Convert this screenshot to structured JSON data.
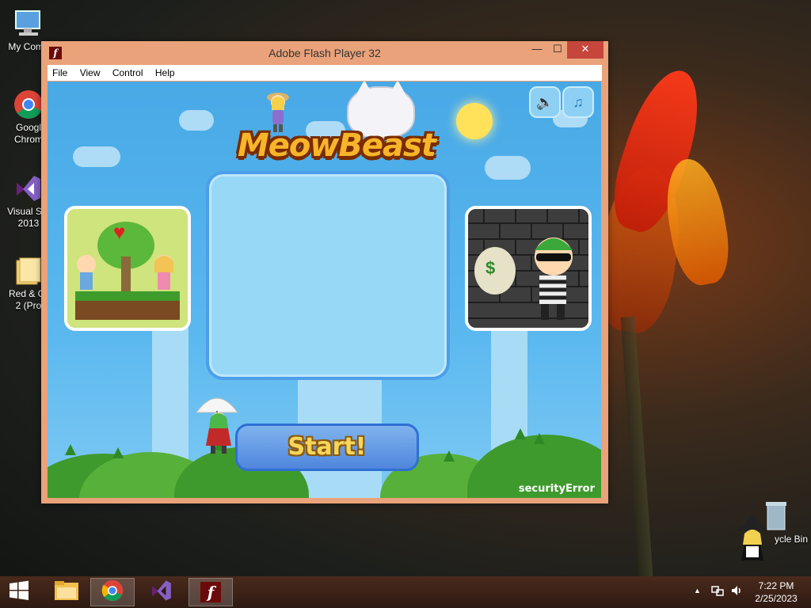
{
  "desktop": {
    "icons": [
      {
        "label": "My Comp",
        "icon": "computer-icon"
      },
      {
        "label": "Googl",
        "label2": "Chrom",
        "icon": "chrome-icon"
      },
      {
        "label": "Visual Stu",
        "label2": "2013",
        "icon": "visual-studio-icon"
      },
      {
        "label": "Red & Gr",
        "label2": "2 (Pro",
        "icon": "folder-icon"
      },
      {
        "label": "ycle Bin",
        "icon": "recycle-bin-icon"
      }
    ]
  },
  "window": {
    "title": "Adobe Flash Player 32",
    "app_icon_glyph": "f",
    "controls": {
      "minimize": "—",
      "maximize": "☐",
      "close": "✕"
    },
    "menu": [
      "File",
      "View",
      "Control",
      "Help"
    ]
  },
  "game": {
    "logo_text": "MeowBeast",
    "sound_icon": "speaker-icon",
    "music_icon": "music-note-icon",
    "start_label": "Start!",
    "error_text": "securityError",
    "thumb_left_icon": "heart-icon",
    "thumb_right_icon": "money-bag-icon",
    "money_symbol": "$"
  },
  "taskbar": {
    "start_icon": "windows-logo-icon",
    "apps": [
      {
        "name": "file-explorer",
        "icon": "folder-icon",
        "active": false
      },
      {
        "name": "chrome",
        "icon": "chrome-icon",
        "active": true
      },
      {
        "name": "visual-studio",
        "icon": "visual-studio-icon",
        "active": false
      },
      {
        "name": "flash-player",
        "icon": "flash-icon",
        "active": true
      }
    ],
    "tray_icons": [
      "show-hidden-icon",
      "network-icon",
      "volume-icon"
    ],
    "time": "7:22 PM",
    "date": "2/25/2023"
  },
  "colors": {
    "window_frame": "#e9a27a",
    "close_button": "#c7463c",
    "game_sky": "#48a9e6",
    "start_button": "#4f86dc",
    "start_text": "#f7d65a"
  }
}
